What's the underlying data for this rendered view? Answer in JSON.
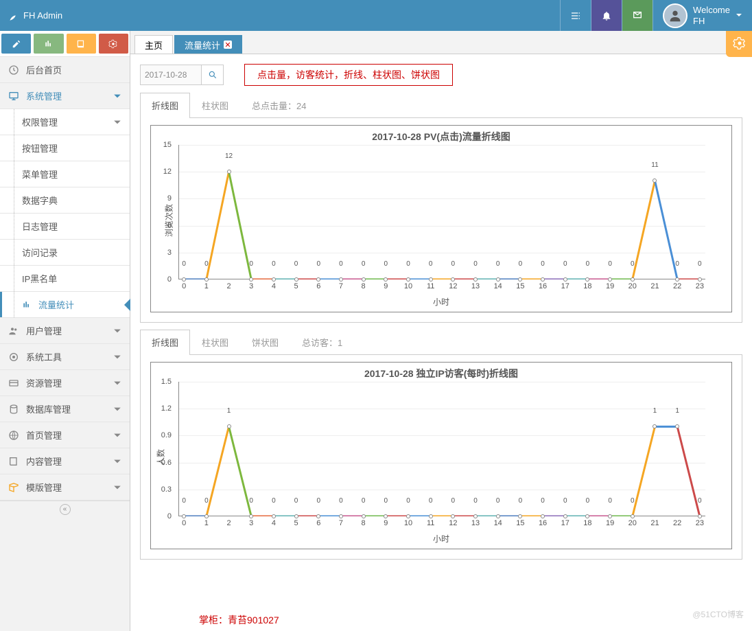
{
  "brand": "FH Admin",
  "user": {
    "welcome": "Welcome",
    "name": "FH"
  },
  "tabs": [
    {
      "label": "主页"
    },
    {
      "label": "流量统计"
    }
  ],
  "sidebar": {
    "home": "后台首页",
    "sys": "系统管理",
    "sub": [
      "权限管理",
      "按钮管理",
      "菜单管理",
      "数据字典",
      "日志管理",
      "访问记录",
      "IP黑名单",
      "流量统计"
    ],
    "user": "用户管理",
    "tools": "系统工具",
    "res": "资源管理",
    "db": "数据库管理",
    "homepage": "首页管理",
    "content": "内容管理",
    "template": "模版管理"
  },
  "date": "2017-10-28",
  "desc": "点击量，访客统计，折线、柱状图、饼状图",
  "chart_tabs1": [
    "折线图",
    "柱状图",
    "总点击量：24"
  ],
  "chart_tabs2": [
    "折线图",
    "柱状图",
    "饼状图",
    "总访客：1"
  ],
  "chart_data": [
    {
      "type": "line",
      "title": "2017-10-28  PV(点击)流量折线图",
      "xlabel": "小时",
      "ylabel": "浏览次数",
      "x": [
        0,
        1,
        2,
        3,
        4,
        5,
        6,
        7,
        8,
        9,
        10,
        11,
        12,
        13,
        14,
        15,
        16,
        17,
        18,
        19,
        20,
        21,
        22,
        23
      ],
      "values": [
        0,
        0,
        12,
        0,
        0,
        0,
        0,
        0,
        0,
        0,
        0,
        0,
        0,
        0,
        0,
        0,
        0,
        0,
        0,
        0,
        0,
        11,
        0,
        0
      ],
      "ylim": [
        0,
        15
      ],
      "yticks": [
        0,
        3,
        6,
        9,
        12,
        15
      ]
    },
    {
      "type": "line",
      "title": "2017-10-28  独立IP访客(每时)折线图",
      "xlabel": "小时",
      "ylabel": "人数",
      "x": [
        0,
        1,
        2,
        3,
        4,
        5,
        6,
        7,
        8,
        9,
        10,
        11,
        12,
        13,
        14,
        15,
        16,
        17,
        18,
        19,
        20,
        21,
        22,
        23
      ],
      "values": [
        0,
        0,
        1,
        0,
        0,
        0,
        0,
        0,
        0,
        0,
        0,
        0,
        0,
        0,
        0,
        0,
        0,
        0,
        0,
        0,
        0,
        1,
        1,
        0
      ],
      "ylim": [
        0,
        1.5
      ],
      "yticks": [
        0,
        0.3,
        0.6,
        0.9,
        1.2,
        1.5
      ]
    }
  ],
  "footer": "掌柜：青苔901027",
  "watermark": "@51CTO博客",
  "colors": [
    "#4f7fbf",
    "#f5a623",
    "#7db83e",
    "#e56a3e",
    "#5fb1b1",
    "#cc4a4a",
    "#4a8fd6",
    "#c8588f",
    "#6fb84d",
    "#cc4a4a",
    "#4a8fd6",
    "#f5a623",
    "#cc4a4a",
    "#5fb1b1",
    "#4f7fbf",
    "#f5a623",
    "#8b6db8",
    "#5fb1b1",
    "#c8588f",
    "#6fb84d",
    "#f5a623",
    "#4a8fd6",
    "#cc4a4a",
    "#4f7fbf"
  ]
}
